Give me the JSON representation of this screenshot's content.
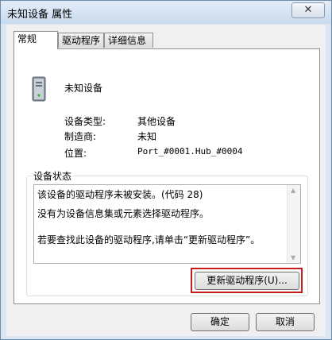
{
  "window": {
    "title": "未知设备 属性",
    "close_symbol": "✕"
  },
  "tabs": [
    {
      "label": "常规",
      "active": true
    },
    {
      "label": "驱动程序",
      "active": false
    },
    {
      "label": "详细信息",
      "active": false
    }
  ],
  "device": {
    "name": "未知设备",
    "icon": "computer-tower-icon",
    "properties": [
      {
        "label": "设备类型:",
        "value": "其他设备"
      },
      {
        "label": "制造商:",
        "value": "未知"
      },
      {
        "label": "位置:",
        "value": "Port_#0001.Hub_#0004"
      }
    ]
  },
  "status": {
    "legend": "设备状态",
    "lines": [
      "该设备的驱动程序未被安装。(代码 28)",
      "没有为设备信息集或元素选择驱动程序。",
      "若要查找此设备的驱动程序,请单击“更新驱动程序”。"
    ],
    "update_button": "更新驱动程序(U)..."
  },
  "buttons": {
    "ok": "确定",
    "cancel": "取消"
  },
  "colors": {
    "highlight": "#c81a1a"
  }
}
